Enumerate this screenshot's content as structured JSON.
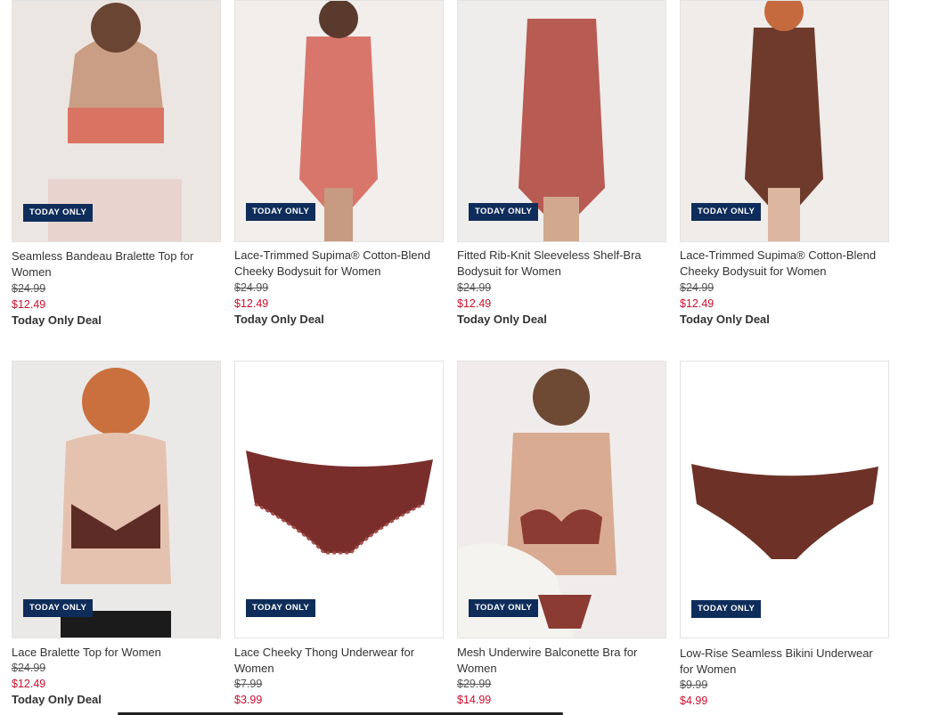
{
  "badge_label": "TODAY ONLY",
  "deal_label": "Today Only Deal",
  "colors": {
    "sale": "#c8102e",
    "badge_bg": "#0f2d5a"
  },
  "products": [
    {
      "title": "Seamless Bandeau Bralette Top for Women",
      "original_price": "$24.99",
      "sale_price": "$12.49"
    },
    {
      "title": "Lace-Trimmed Supima® Cotton-Blend Cheeky Bodysuit for Women",
      "original_price": "$24.99",
      "sale_price": "$12.49"
    },
    {
      "title": "Fitted Rib-Knit Sleeveless Shelf-Bra Bodysuit for Women",
      "original_price": "$24.99",
      "sale_price": "$12.49"
    },
    {
      "title": "Lace-Trimmed Supima® Cotton-Blend Cheeky Bodysuit for Women",
      "original_price": "$24.99",
      "sale_price": "$12.49"
    },
    {
      "title": "Lace Bralette Top for Women",
      "original_price": "$24.99",
      "sale_price": "$12.49"
    },
    {
      "title": "Lace Cheeky Thong Underwear for Women",
      "original_price": "$7.99",
      "sale_price": "$3.99"
    },
    {
      "title": "Mesh Underwire Balconette Bra for Women",
      "original_price": "$29.99",
      "sale_price": "$14.99"
    },
    {
      "title": "Low-Rise Seamless Bikini Underwear for Women",
      "original_price": "$9.99",
      "sale_price": "$4.99"
    }
  ]
}
